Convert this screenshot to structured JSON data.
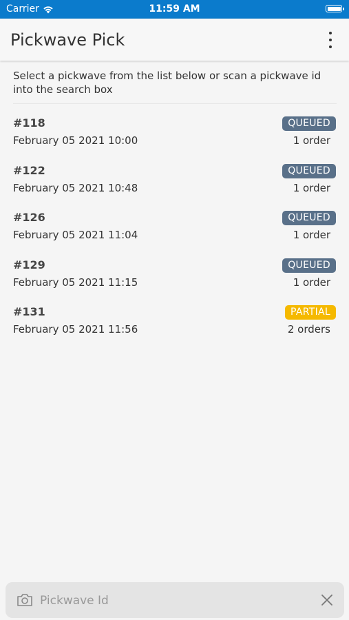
{
  "status_bar": {
    "carrier": "Carrier",
    "time": "11:59 AM"
  },
  "app_bar": {
    "title": "Pickwave Pick",
    "menu_icon": "more-vertical-icon"
  },
  "intro_text": "Select a pickwave from the list below or scan a pickwave id into the search box",
  "pickwaves": [
    {
      "id": "#118",
      "date": "February 05 2021 10:00",
      "status": "QUEUED",
      "orders": "1 order"
    },
    {
      "id": "#122",
      "date": "February 05 2021 10:48",
      "status": "QUEUED",
      "orders": "1 order"
    },
    {
      "id": "#126",
      "date": "February 05 2021 11:04",
      "status": "QUEUED",
      "orders": "1 order"
    },
    {
      "id": "#129",
      "date": "February 05 2021 11:15",
      "status": "QUEUED",
      "orders": "1 order"
    },
    {
      "id": "#131",
      "date": "February 05 2021 11:56",
      "status": "PARTIAL",
      "orders": "2 orders"
    }
  ],
  "search": {
    "placeholder": "Pickwave Id",
    "value": "",
    "camera_icon": "camera-icon",
    "clear_icon": "close-icon"
  },
  "colors": {
    "status_bar": "#0b7bcc",
    "queued_badge": "#597089",
    "partial_badge": "#f5b900"
  }
}
